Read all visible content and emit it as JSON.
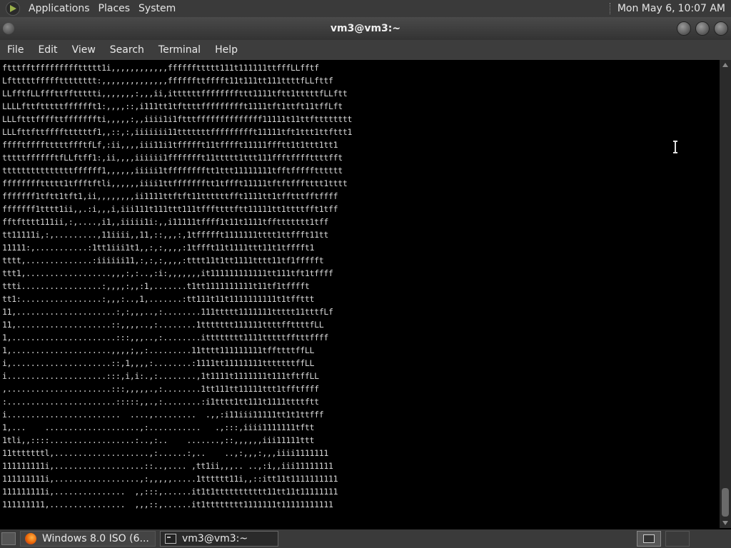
{
  "top_panel": {
    "menus": [
      "Applications",
      "Places",
      "System"
    ],
    "date": "Mon May  6,",
    "time": "10:07 AM"
  },
  "window": {
    "title": "vm3@vm3:~"
  },
  "menubar": {
    "items": [
      "File",
      "Edit",
      "View",
      "Search",
      "Terminal",
      "Help"
    ]
  },
  "terminal": {
    "lines": [
      "ftttfftfffffffffttttt1i,,,,,,,,,,,,ffffffttttt111t111111ttfffLLfftf",
      "Lftttttffffftttttttt:,,,,,,,,,,,,,,ffffffttfffft11t111tt111ttttfLLfttf",
      "LLfftfLLfffttffttttti,,,,,,,:,,,ii,ittttttffffffffttt1111tftt1tttttfLLftt",
      "LLLLfttftttttfffffft1:,,,,::,i111tt1tfttttffffffffft1111tft1ttft11tffLft",
      "LLLftttffffttfffffffti,,,,,:,,iiii1i1ftttffffffffffffff11111t11ttftttttttt",
      "LLLfttfttffffttttttf1,,::,:,iiiiiii11tttttttffffffffft11111tft1ttt1ttfttt1",
      "fffftfffftttttffftfLf,:ii,,,,iii11i1tffffft11tfffft11111ffftt1t1ttt1tt1",
      "tttttfffffftfLLftff1:,ii,,,,iiiiii1ffffffft11ttttt1ttt111ffftffffttttfft",
      "tttttttttttttttffffff1,,,,,,iiiii1tfffffffftt1ttt11111111tfftffffftttttt",
      "ffffffffttttt1tffftftli,,,,,,iiii1ttffffffftt1tffft11111tftftffftttt1tttt",
      "fffffff1tftt1tft1,ii,,,,,,,,ii1111ttftft11ttttttfft1111tt1tfftttfftffff",
      "fffffff1tttt1ii,,.:i,,,i,iii111t111ttt111tfffttttftt11111tt1ttttfft1tff",
      "fftftttt111ii,:,....,i1,,iiiii1i:,,i11111tffff1t11t1111tffttttttt1tff",
      "tt11111i,:,.........,11iiii,,11,::,,,:,1tffffft1111111tttt1ttffft11tt",
      "11111:,...........:1tt1iii1t1,,:,:,,,,:1tffft11t1111ttt11t1tfffft1",
      "tttt,..............:iiiiii11,:,:,:,,,,:tttt11t1tt1111tttt11tf1ffffft",
      "ttt1,..................,,,:,:..,:i:,,,,,,,it111111111111tt111tft1tffff",
      "ttti.................:,,,,:,,:1,.......t1tt1111111111t11tf1tfffft",
      "tt1:.................:,,,:..,1,.......:tt111t11t1111111111t1tffttt",
      "11,.....................:,:,,,..,:........111ttttt1111111ttttt11tttfLf",
      "11,....................::,,,,..,:........1ttttttt111111ttttffttttfLL",
      "1,......................:::,,,..,:........itttttttt1111tttttfftttffff",
      "1,.....................,,,,;,,:.........11tttt111111111tffttttffLL",
      "i,.....................::,1,,,,:........:1111tt11111111tttttttffLL",
      "i.....................:::,i,i:.,:........,1t1111t1111111t111tftffLL",
      ",......................:::,,,,,.,:........1tt111tt11111ttt1tfftffff",
      ":.......................:::::,,.,:........:i1tttt1tt111t1111ttttftt",
      "i........................  ....,.........  .,,:i11iii11111tt1t1ttfff",
      "1,...    ....................,:...........   .,:::,iiii1111111tftt",
      "1tli,,::::..................:..,:..    .......,::,,,,,,iii11111ttt",
      "11tttttttl,....................,:......:,..    ..,:,,,:,,,iiii1111111",
      "111111111i,...................::..,.... ,tt1ii,,,.. ..,:i,,iii11111111",
      "111111111i,..................,:,,,,,.....1tttttt11i,,::itt11t1111111111",
      "111111111i,...............  ,,:::,......it1t1ttttttttttt11tt11t11111111",
      "111111111,................  ,,,::,......it1tttttttt1111111t11111111111"
    ]
  },
  "taskbar": {
    "tasks": [
      {
        "label": "Windows 8.0 ISO (6..."
      },
      {
        "label": "vm3@vm3:~"
      }
    ]
  }
}
